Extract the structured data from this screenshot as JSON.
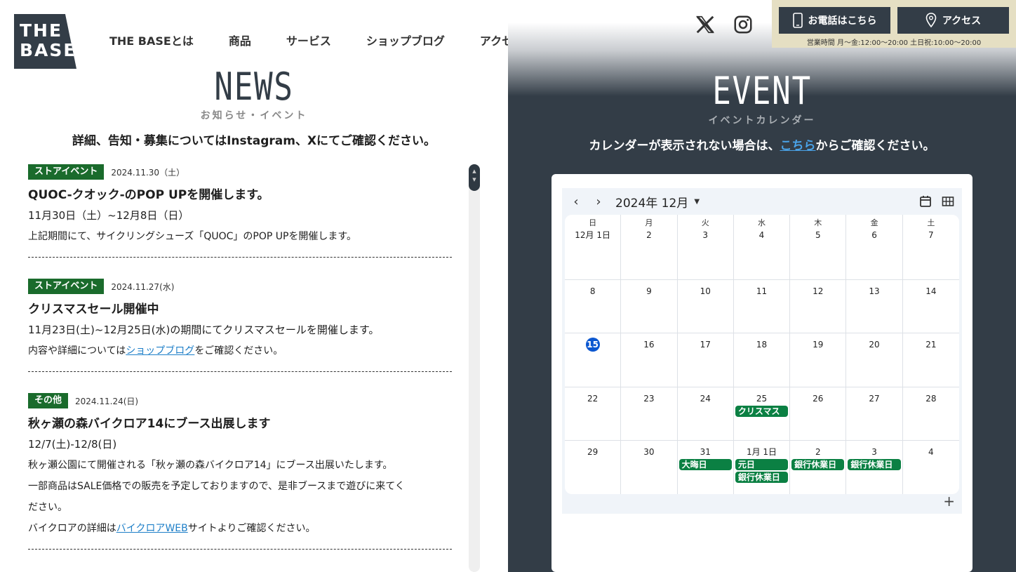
{
  "header": {
    "logo_line1": "THE",
    "logo_line2": "BASE",
    "nav": [
      "THE BASEとは",
      "商品",
      "サービス",
      "ショップブログ",
      "アクセス"
    ],
    "phone_label": "お電話はこちら",
    "access_label": "アクセス",
    "hours": "営業時間 月〜金:12:00〜20:00 土日祝:10:00〜20:00",
    "icons": [
      "x-icon",
      "instagram-icon",
      "phone-icon",
      "map-pin-icon"
    ]
  },
  "news": {
    "title": "NEWS",
    "subtitle": "お知らせ・イベント",
    "note": "詳細、告知・募集についてはInstagram、Xにてご確認ください。",
    "items": [
      {
        "tag": "ストアイベント",
        "date": "2024.11.30（土）",
        "headline": "QUOC-クオック-のPOP UPを開催します。",
        "period": "11月30日（土）~12月8日（日）",
        "body1": "上記期間にて、サイクリングシューズ「QUOC」のPOP UPを開催します。"
      },
      {
        "tag": "ストアイベント",
        "date": "2024.11.27(水)",
        "headline": "クリスマスセール開催中",
        "period": "11月23日(土)~12月25日(水)の期間にてクリスマスセールを開催します。",
        "body_pre": "内容や詳細については",
        "link": "ショップブログ",
        "body_post": "をご確認ください。"
      },
      {
        "tag": "その他",
        "date": "2024.11.24(日)",
        "headline": "秋ヶ瀬の森バイクロア14にブース出展します",
        "period": "12/7(土)-12/8(日)",
        "body1": "秋ヶ瀬公園にて開催される「秋ヶ瀬の森バイクロア14」にブース出展いたします。",
        "body2": "一部商品はSALE価格での販売を予定しておりますので、是非ブースまで遊びに来てく",
        "body3": "ださい。",
        "body_pre": "バイクロアの詳細は",
        "link": "バイクロアWEB",
        "body_post": "サイトよりご確認ください。"
      }
    ]
  },
  "event": {
    "title": "EVENT",
    "subtitle": "イベントカレンダー",
    "note_pre": "カレンダーが表示されない場合は、",
    "note_link": "こちら",
    "note_post": "からご確認ください。"
  },
  "calendar": {
    "month_label": "2024年 12月",
    "weekdays": [
      "日",
      "月",
      "火",
      "水",
      "木",
      "金",
      "土"
    ],
    "today": "15",
    "weeks": [
      [
        {
          "d": "12月 1日"
        },
        {
          "d": "2"
        },
        {
          "d": "3"
        },
        {
          "d": "4"
        },
        {
          "d": "5"
        },
        {
          "d": "6"
        },
        {
          "d": "7"
        }
      ],
      [
        {
          "d": "8"
        },
        {
          "d": "9"
        },
        {
          "d": "10"
        },
        {
          "d": "11"
        },
        {
          "d": "12"
        },
        {
          "d": "13"
        },
        {
          "d": "14"
        }
      ],
      [
        {
          "d": "15"
        },
        {
          "d": "16"
        },
        {
          "d": "17"
        },
        {
          "d": "18"
        },
        {
          "d": "19"
        },
        {
          "d": "20"
        },
        {
          "d": "21"
        }
      ],
      [
        {
          "d": "22"
        },
        {
          "d": "23"
        },
        {
          "d": "24"
        },
        {
          "d": "25",
          "e": [
            "クリスマス"
          ]
        },
        {
          "d": "26"
        },
        {
          "d": "27"
        },
        {
          "d": "28"
        }
      ],
      [
        {
          "d": "29"
        },
        {
          "d": "30"
        },
        {
          "d": "31",
          "e": [
            "大晦日"
          ]
        },
        {
          "d": "1月 1日",
          "e": [
            "元日",
            "銀行休業日"
          ]
        },
        {
          "d": "2",
          "e": [
            "銀行休業日"
          ]
        },
        {
          "d": "3",
          "e": [
            "銀行休業日"
          ]
        },
        {
          "d": "4"
        }
      ]
    ],
    "event_color": "#0b8043",
    "today_color": "#0b57d0"
  }
}
